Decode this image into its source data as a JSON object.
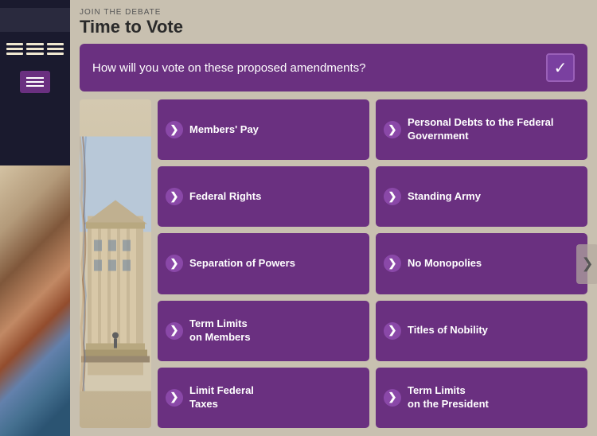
{
  "header": {
    "join_label": "JOIN THE DEBATE",
    "page_title": "Time to Vote"
  },
  "question": {
    "text": "How will you vote on these proposed amendments?",
    "check_icon": "✓"
  },
  "buttons": [
    {
      "id": "members-pay",
      "label": "Members' Pay",
      "col": 1,
      "row": 1
    },
    {
      "id": "personal-debts",
      "label": "Personal Debts to the Federal Government",
      "col": 2,
      "row": 1
    },
    {
      "id": "federal-rights",
      "label": "Federal Rights",
      "col": 1,
      "row": 2
    },
    {
      "id": "standing-army",
      "label": "Standing Army",
      "col": 2,
      "row": 2
    },
    {
      "id": "separation-of-powers",
      "label": "Separation of Powers",
      "col": 1,
      "row": 3
    },
    {
      "id": "no-monopolies",
      "label": "No Monopolies",
      "col": 2,
      "row": 3
    },
    {
      "id": "term-limits-members",
      "label": "Term Limits on Members",
      "col": 1,
      "row": 4
    },
    {
      "id": "titles-of-nobility",
      "label": "Titles of Nobility",
      "col": 2,
      "row": 4
    },
    {
      "id": "limit-federal-taxes",
      "label": "Limit Federal Taxes",
      "col": 1,
      "row": 5
    },
    {
      "id": "term-limits-president",
      "label": "Term Limits on the President",
      "col": 2,
      "row": 5
    }
  ],
  "nav": {
    "left_arrow": "❮",
    "right_arrow": "❯"
  },
  "sidebar": {
    "lines": [
      "line1",
      "line2",
      "line3"
    ]
  }
}
